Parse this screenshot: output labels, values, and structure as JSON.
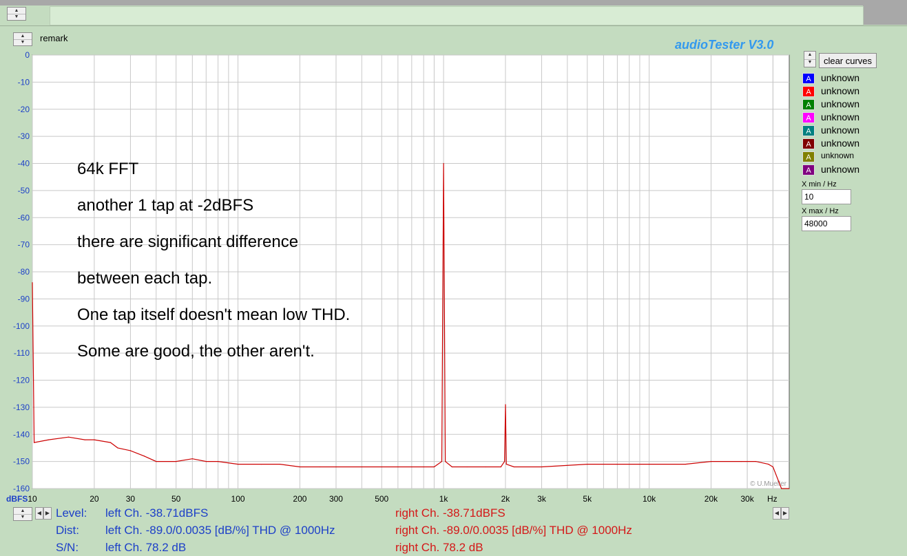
{
  "app": {
    "brand": "audioTester  V3.0",
    "remark_label": "remark",
    "copyright": "© U.Mueller"
  },
  "controls": {
    "clear_curves": "clear curves",
    "xmin_label": "X min / Hz",
    "xmin_value": "10",
    "xmax_label": "X max / Hz",
    "xmax_value": "48000"
  },
  "legend": [
    {
      "letter": "A",
      "label": "unknown",
      "color": "#0000ff"
    },
    {
      "letter": "A",
      "label": "unknown",
      "color": "#ff0000"
    },
    {
      "letter": "A",
      "label": "unknown",
      "color": "#008000"
    },
    {
      "letter": "A",
      "label": "unknown",
      "color": "#ff00ff"
    },
    {
      "letter": "A",
      "label": "unknown",
      "color": "#008080"
    },
    {
      "letter": "A",
      "label": "unknown",
      "color": "#800000"
    },
    {
      "letter": "A",
      "label": "unknown",
      "color": "#808000"
    },
    {
      "letter": "A",
      "label": "unknown",
      "color": "#800080"
    }
  ],
  "annotation": [
    "64k FFT",
    "another 1 tap at -2dBFS",
    "there are significant difference",
    "between each tap.",
    "One tap itself doesn't mean low THD.",
    "Some are good, the other aren't."
  ],
  "readout": {
    "level_label": "Level:",
    "dist_label": "Dist:",
    "sn_label": "S/N:",
    "left_level": "left Ch. -38.71dBFS",
    "left_dist": "left Ch. -89.0/0.0035 [dB/%] THD @ 1000Hz",
    "left_sn": "left Ch. 78.2 dB",
    "right_level": "right Ch. -38.71dBFS",
    "right_dist": "right Ch. -89.0/0.0035 [dB/%] THD @ 1000Hz",
    "right_sn": "right Ch. 78.2 dB"
  },
  "chart_data": {
    "type": "line",
    "xscale": "log",
    "xlim": [
      10,
      48000
    ],
    "ylim": [
      -160,
      0
    ],
    "grid": true,
    "ylabel": "dBFS",
    "xlabel": "Hz",
    "y_ticks": [
      0,
      -10,
      -20,
      -30,
      -40,
      -50,
      -60,
      -70,
      -80,
      -90,
      -100,
      -110,
      -120,
      -130,
      -140,
      -150,
      -160
    ],
    "x_ticks": [
      {
        "v": 10,
        "label": "10"
      },
      {
        "v": 20,
        "label": "20"
      },
      {
        "v": 30,
        "label": "30"
      },
      {
        "v": 50,
        "label": "50"
      },
      {
        "v": 100,
        "label": "100"
      },
      {
        "v": 200,
        "label": "200"
      },
      {
        "v": 300,
        "label": "300"
      },
      {
        "v": 500,
        "label": "500"
      },
      {
        "v": 1000,
        "label": "1k"
      },
      {
        "v": 2000,
        "label": "2k"
      },
      {
        "v": 3000,
        "label": "3k"
      },
      {
        "v": 5000,
        "label": "5k"
      },
      {
        "v": 10000,
        "label": "10k"
      },
      {
        "v": 20000,
        "label": "20k"
      },
      {
        "v": 30000,
        "label": "30k"
      }
    ],
    "series": [
      {
        "color": "#cc0000",
        "points": [
          [
            10,
            -84
          ],
          [
            10.2,
            -143
          ],
          [
            12,
            -142
          ],
          [
            15,
            -141
          ],
          [
            18,
            -142
          ],
          [
            20,
            -142
          ],
          [
            24,
            -143
          ],
          [
            26,
            -145
          ],
          [
            30,
            -146
          ],
          [
            35,
            -148
          ],
          [
            40,
            -150
          ],
          [
            50,
            -150
          ],
          [
            60,
            -149
          ],
          [
            70,
            -150
          ],
          [
            80,
            -150
          ],
          [
            100,
            -151
          ],
          [
            130,
            -151
          ],
          [
            160,
            -151
          ],
          [
            200,
            -152
          ],
          [
            250,
            -152
          ],
          [
            300,
            -152
          ],
          [
            400,
            -152
          ],
          [
            500,
            -152
          ],
          [
            600,
            -152
          ],
          [
            700,
            -152
          ],
          [
            800,
            -152
          ],
          [
            900,
            -152
          ],
          [
            980,
            -150
          ],
          [
            1000,
            -40
          ],
          [
            1020,
            -150
          ],
          [
            1100,
            -152
          ],
          [
            1300,
            -152
          ],
          [
            1600,
            -152
          ],
          [
            1900,
            -152
          ],
          [
            1980,
            -150
          ],
          [
            2000,
            -129
          ],
          [
            2020,
            -151
          ],
          [
            2200,
            -152
          ],
          [
            3000,
            -152
          ],
          [
            5000,
            -151
          ],
          [
            7000,
            -151
          ],
          [
            10000,
            -151
          ],
          [
            15000,
            -151
          ],
          [
            20000,
            -150
          ],
          [
            28000,
            -150
          ],
          [
            33000,
            -150
          ],
          [
            38000,
            -151
          ],
          [
            40000,
            -152
          ],
          [
            44000,
            -160
          ],
          [
            48000,
            -160
          ]
        ]
      }
    ]
  }
}
